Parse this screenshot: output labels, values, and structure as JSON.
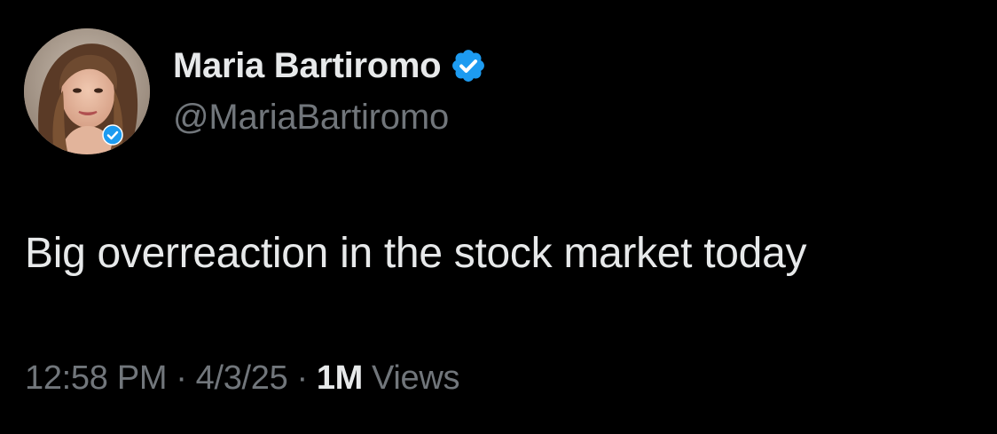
{
  "user": {
    "display_name": "Maria Bartiromo",
    "handle": "@MariaBartiromo",
    "verified_icon": "verified-badge-icon",
    "verified_color": "#1d9bf0"
  },
  "tweet": {
    "text": "Big overreaction in the stock market today"
  },
  "meta": {
    "time": "12:58 PM",
    "separator": "·",
    "date": "4/3/25",
    "views_count": "1M",
    "views_label": "Views"
  },
  "colors": {
    "background": "#000000",
    "primary_text": "#e7e9ea",
    "secondary_text": "#71767b",
    "accent": "#1d9bf0"
  }
}
